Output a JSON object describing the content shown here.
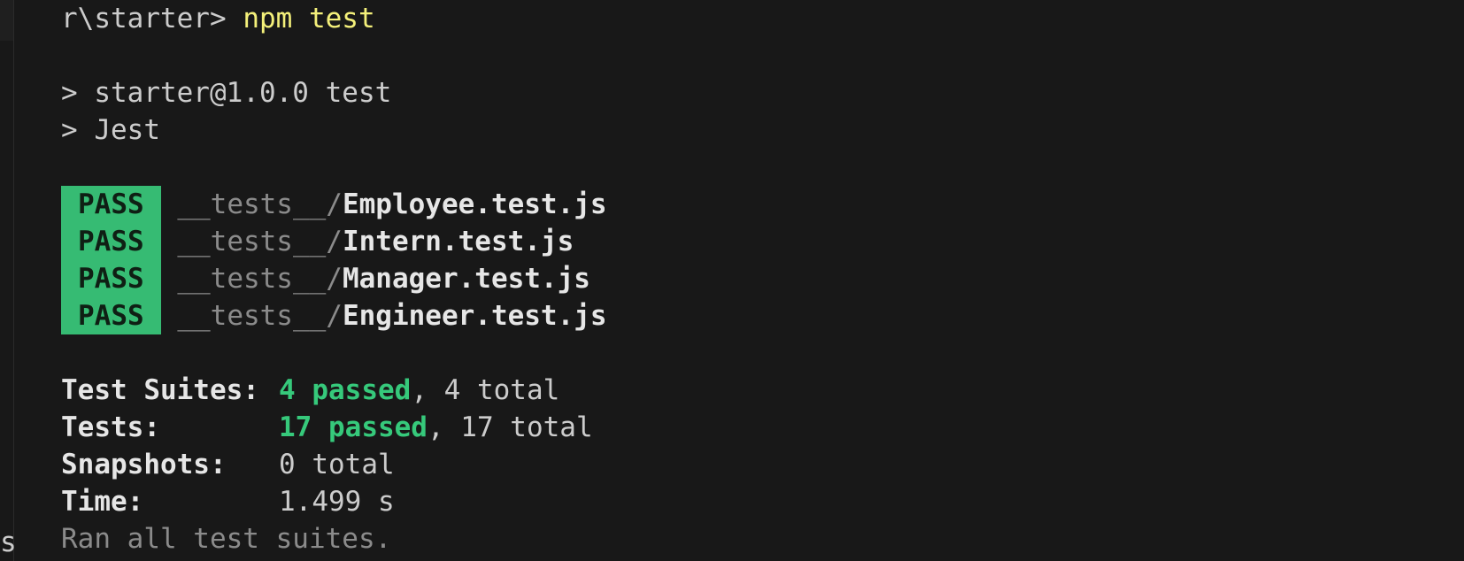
{
  "prompt": {
    "path": "r\\starter>",
    "command": "npm test"
  },
  "script_lines": [
    "> starter@1.0.0 test",
    "> Jest"
  ],
  "results": [
    {
      "status": "PASS",
      "dir": "__tests__/",
      "file": "Employee.test.js"
    },
    {
      "status": "PASS",
      "dir": "__tests__/",
      "file": "Intern.test.js"
    },
    {
      "status": "PASS",
      "dir": "__tests__/",
      "file": "Manager.test.js"
    },
    {
      "status": "PASS",
      "dir": "__tests__/",
      "file": "Engineer.test.js"
    }
  ],
  "summary": {
    "suites": {
      "label": "Test Suites:",
      "passed": "4 passed",
      "rest": ", 4 total"
    },
    "tests": {
      "label": "Tests:",
      "passed": "17 passed",
      "rest": ", 17 total"
    },
    "snapshots": {
      "label": "Snapshots:",
      "value": "0 total"
    },
    "time": {
      "label": "Time:",
      "value": "1.499 s"
    },
    "footer": "Ran all test suites."
  },
  "edge_char": "s",
  "colors": {
    "background": "#181818",
    "pass_badge": "#36bb73",
    "passed_text": "#36c97b",
    "command": "#f4f07a"
  }
}
